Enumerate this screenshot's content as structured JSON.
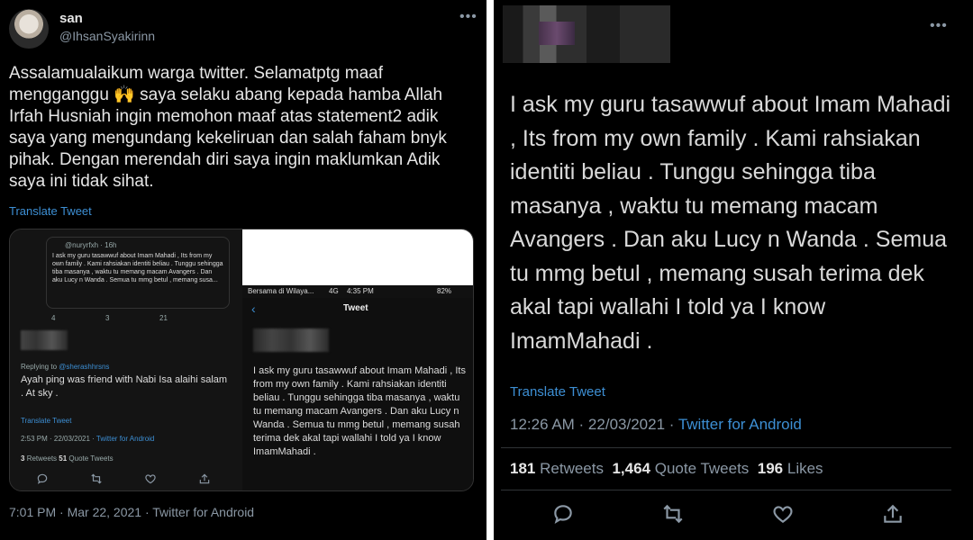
{
  "left": {
    "author_name": "san",
    "author_handle": "@IhsanSyakirinn",
    "body": "Assalamualaikum warga twitter. Selamatptg maaf mengganggu 🙌 saya selaku abang kepada hamba Allah Irfah Husniah ingin memohon maaf atas statement2 adik saya yang mengundang kekeliruan dan salah faham bnyk pihak. Dengan merendah diri saya ingin maklumkan Adik saya ini tidak sihat.",
    "translate": "Translate Tweet",
    "footer": "7:01 PM · Mar 22, 2021 · Twitter for Android",
    "embed": {
      "qt_user": "@nuryrfxh · 16h",
      "qt_text": "I ask my guru tasawwuf about Imam Mahadi , Its from my own family . Kami rahsiakan identiti beliau . Tunggu sehingga tiba masanya , waktu tu memang macam Avangers . Dan aku Lucy n Wanda . Semua tu mmg betul , memang susa...",
      "qt_counts": [
        "4",
        "3",
        "21"
      ],
      "replying_prefix": "Replying to",
      "replying_handle": "@sherashhrsns",
      "reply_text": "Ayah ping was friend with Nabi Isa alaihi salam . At sky .",
      "reply_translate": "Translate Tweet",
      "reply_meta_time": "2:53 PM · 22/03/2021 ·",
      "reply_meta_source": "Twitter for Android",
      "reply_retweets_num": "3",
      "reply_retweets_label": "Retweets",
      "reply_quotes_num": "51",
      "reply_quotes_label": "Quote Tweets",
      "status_left": "Bersama di Wilaya...",
      "status_net": "4G",
      "status_time": "4:35 PM",
      "status_battery": "82%",
      "phone_title": "Tweet",
      "phone_text": "I ask my guru tasawwuf about Imam Mahadi , Its from my own family . Kami rahsiakan identiti beliau . Tunggu sehingga tiba masanya , waktu tu memang macam Avangers . Dan aku Lucy n Wanda . Semua tu mmg betul , memang susah terima dek akal tapi wallahi I told ya I know ImamMahadi ."
    }
  },
  "right": {
    "body": "I ask my guru tasawwuf about Imam Mahadi , Its from my own family . Kami rahsiakan identiti beliau . Tunggu sehingga tiba masanya , waktu tu memang macam Avangers . Dan aku Lucy n Wanda . Semua tu mmg betul , memang susah terima dek akal tapi wallahi I told ya I know ImamMahadi .",
    "translate": "Translate Tweet",
    "time": "12:26 AM · 22/03/2021 ·",
    "source": "Twitter for Android",
    "retweets_num": "181",
    "retweets_label": "Retweets",
    "quotes_num": "1,464",
    "quotes_label": "Quote Tweets",
    "likes_num": "196",
    "likes_label": "Likes"
  },
  "colors": {
    "background": "#000000",
    "link": "#3d8fd4",
    "muted": "#8b98a5",
    "text": "#d9d9d9"
  },
  "icons": [
    "more-icon",
    "reply-icon",
    "retweet-icon",
    "like-icon",
    "share-icon",
    "back-icon"
  ]
}
